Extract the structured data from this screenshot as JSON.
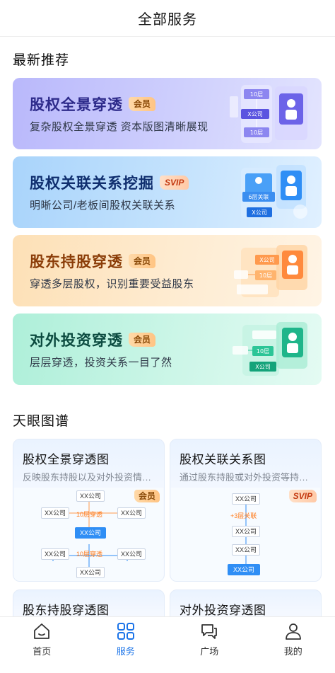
{
  "header": {
    "title": "全部服务"
  },
  "recommend": {
    "section_title": "最新推荐",
    "banners": [
      {
        "title": "股权全景穿透",
        "badge": "会员",
        "subtitle": "复杂股权全景穿透 资本版图清晰展现",
        "art": {
          "n1": "10层",
          "n2": "X公司",
          "n3": "10层"
        }
      },
      {
        "title": "股权关联关系挖掘",
        "badge": "SVIP",
        "subtitle": "明晰公司/老板间股权关联关系",
        "art": {
          "n1": "6层关联",
          "n2": "X公司"
        }
      },
      {
        "title": "股东持股穿透",
        "badge": "会员",
        "subtitle": "穿透多层股权，识别重要受益股东",
        "art": {
          "n1": "X公司",
          "n2": "10层"
        }
      },
      {
        "title": "对外投资穿透",
        "badge": "会员",
        "subtitle": "层层穿透，投资关系一目了然",
        "art": {
          "n1": "10层",
          "n2": "X公司"
        }
      }
    ]
  },
  "graphs": {
    "section_title": "天眼图谱",
    "cards": [
      {
        "title": "股权全景穿透图",
        "desc": "反映股东持股以及对外投资情…",
        "badge": "会员",
        "diagram": {
          "top": "XX公司",
          "left": "XX公司",
          "right": "XX公司",
          "label1": "10层穿透",
          "center": "XX公司",
          "bl": "XX公司",
          "br": "XX公司",
          "label2": "10层穿透",
          "bottom": "XX公司"
        }
      },
      {
        "title": "股权关联关系图",
        "desc": "通过股东持股或对外投资等持…",
        "badge": "SVIP",
        "diagram": {
          "n1": "XX公司",
          "label": "+3层关联",
          "n2": "XX公司",
          "n3": "XX公司",
          "n4": "XX公司"
        }
      },
      {
        "title": "股东持股穿透图"
      },
      {
        "title": "对外投资穿透图"
      }
    ]
  },
  "tabbar": {
    "items": [
      {
        "label": "首页",
        "icon": "home-icon"
      },
      {
        "label": "服务",
        "icon": "grid-icon"
      },
      {
        "label": "广场",
        "icon": "chat-icon"
      },
      {
        "label": "我的",
        "icon": "user-icon"
      }
    ],
    "active_index": 1,
    "active_color": "#1a73e8"
  }
}
